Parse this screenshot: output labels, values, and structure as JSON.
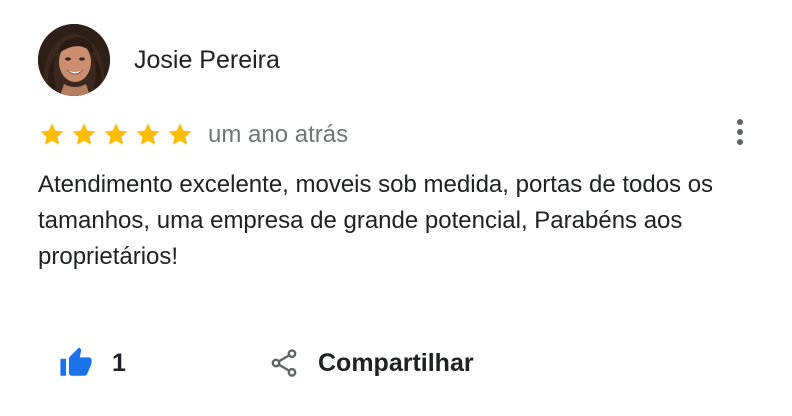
{
  "review": {
    "author": {
      "name": "Josie Pereira",
      "avatar_icon": "profile-photo-icon"
    },
    "rating": {
      "stars": 5,
      "max_stars": 5,
      "star_color": "#fbbc04",
      "star_icon": "star-icon"
    },
    "date": "um ano atrás",
    "more_icon": "more-vert-icon",
    "text": "Atendimento excelente, moveis sob medida, portas de todos os tamanhos, uma empresa de grande potencial, Parabéns aos proprietários!",
    "actions": {
      "like_icon": "thumb-up-icon",
      "like_icon_color": "#1a73e8",
      "like_count": "1",
      "share_icon": "share-icon",
      "share_label": "Compartilhar"
    }
  },
  "colors": {
    "text_primary": "#202124",
    "text_secondary": "#70757a",
    "icon_gray": "#5f6368"
  }
}
